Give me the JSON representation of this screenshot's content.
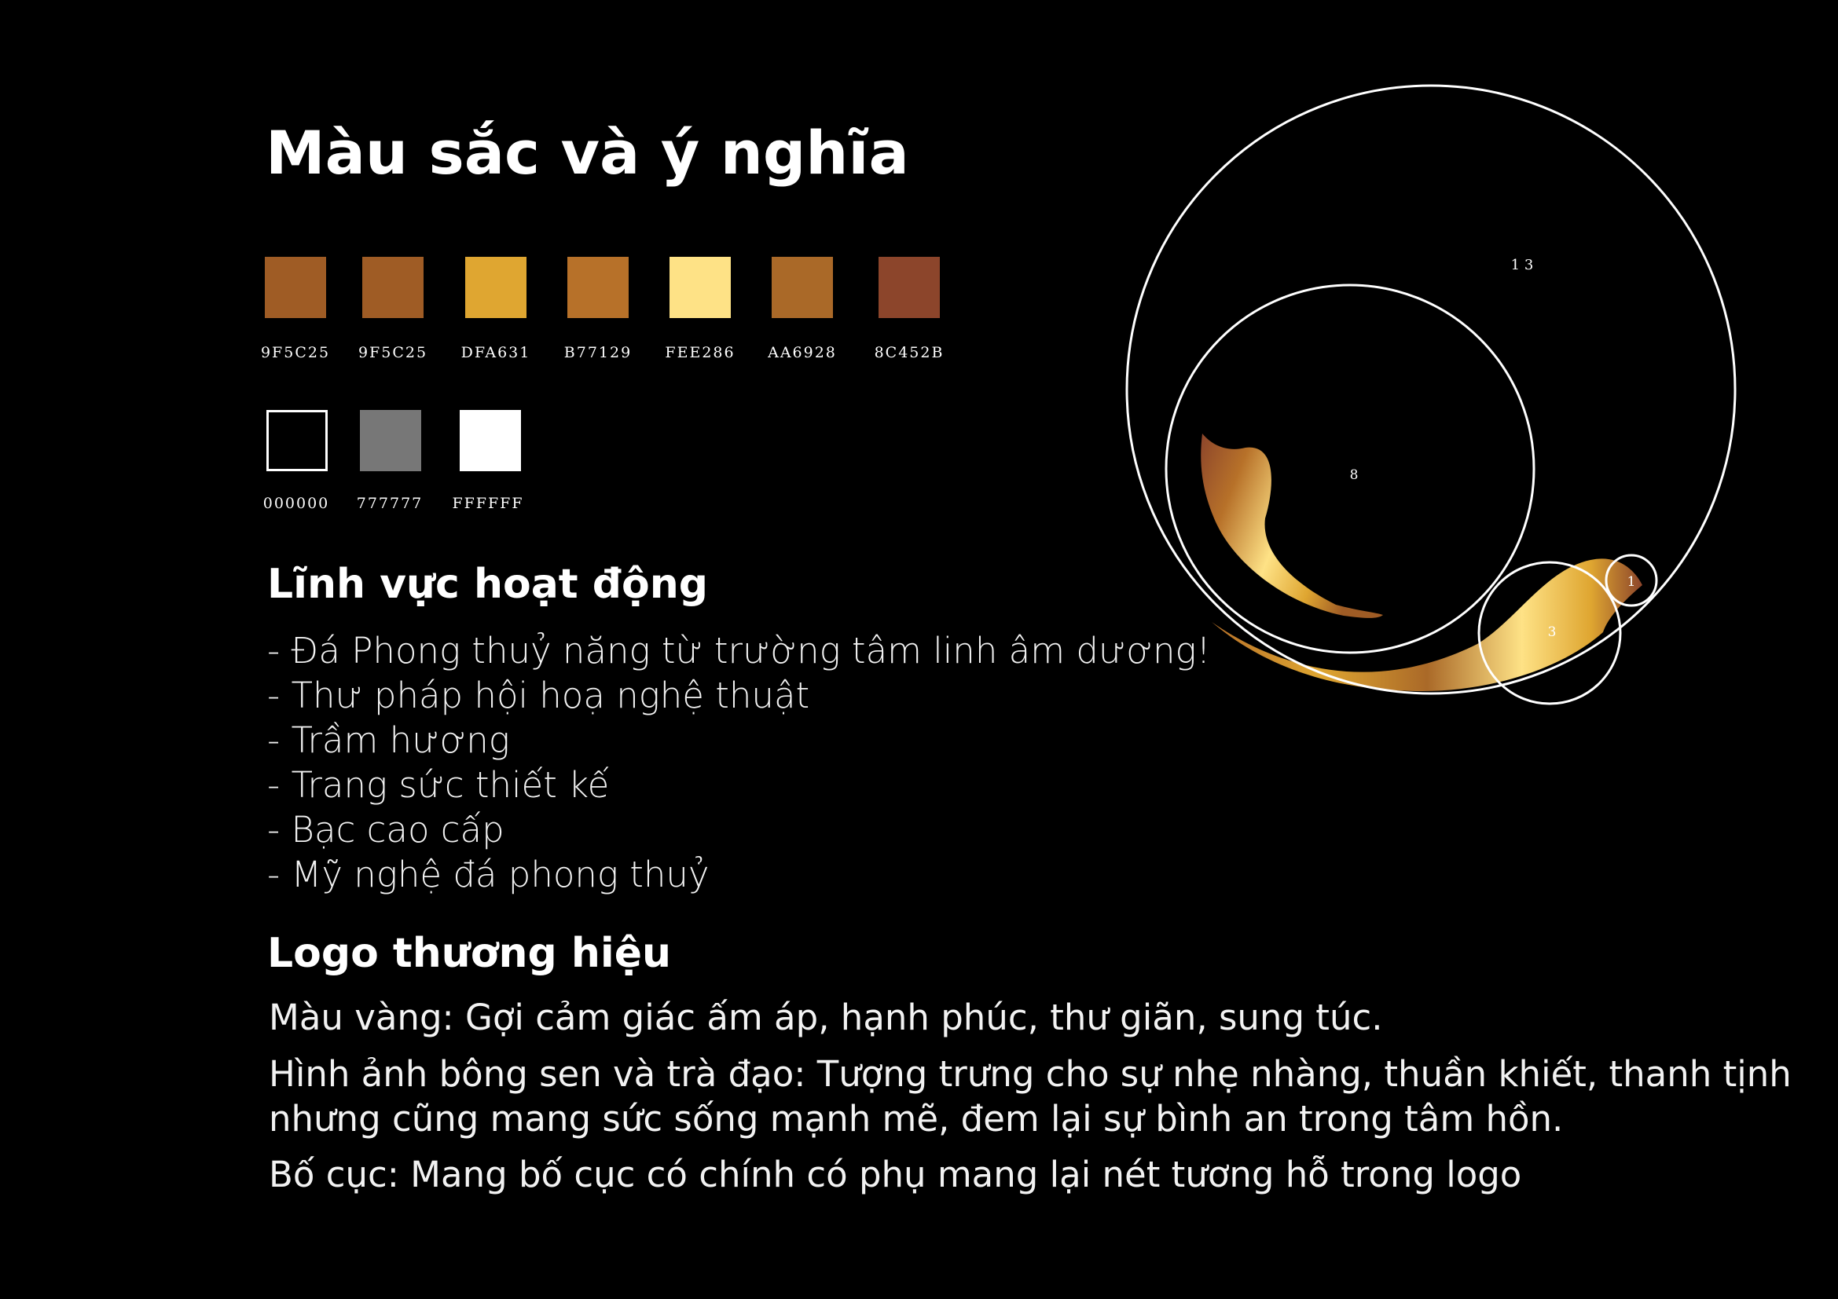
{
  "title": "Màu sắc và ý nghĩa",
  "palette_row1": [
    {
      "hex": "#9F5C25",
      "code": "9F5C25"
    },
    {
      "hex": "#9F5C25",
      "code": "9F5C25"
    },
    {
      "hex": "#DFA631",
      "code": "DFA631"
    },
    {
      "hex": "#B77129",
      "code": "B77129"
    },
    {
      "hex": "#FEE286",
      "code": "FEE286"
    },
    {
      "hex": "#AA6928",
      "code": "AA6928"
    },
    {
      "hex": "#8C452B",
      "code": "8C452B"
    }
  ],
  "palette_row2": [
    {
      "hex": "#000000",
      "code": "000000"
    },
    {
      "hex": "#777777",
      "code": "777777"
    },
    {
      "hex": "#FFFFFF",
      "code": "FFFFFF"
    }
  ],
  "fields": {
    "heading": "Lĩnh vực hoạt động",
    "items": [
      "- Đá Phong thuỷ năng từ trường tâm linh âm dương!",
      "- Thư pháp hội hoạ nghệ thuật",
      "- Trầm hương",
      "- Trang sức thiết kế",
      "- Bạc cao cấp",
      "- Mỹ nghệ đá phong thuỷ"
    ]
  },
  "logo_section": {
    "heading": "Logo thương hiệu",
    "lines": [
      "Màu vàng: Gợi cảm giác ấm áp, hạnh phúc, thư giãn, sung túc.",
      "Hình ảnh bông sen và trà đạo: Tượng trưng cho sự nhẹ nhàng, thuần khiết, thanh tịnh",
      "nhưng cũng mang sức sống mạnh mẽ, đem lại sự bình an trong tâm hồn.",
      "Bố cục: Mang bố cục có chính có phụ mang lại nét tương hỗ trong logo"
    ]
  },
  "golden_ratio_circles": {
    "labels": [
      "1 3",
      "8",
      "3",
      "1"
    ]
  }
}
